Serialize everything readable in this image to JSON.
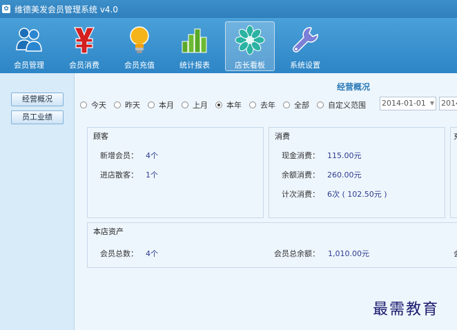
{
  "window": {
    "title": "维德美发会员管理系统 v4.0"
  },
  "toolbar": {
    "items": [
      {
        "label": "会员管理"
      },
      {
        "label": "会员消费"
      },
      {
        "label": "会员充值"
      },
      {
        "label": "统计报表"
      },
      {
        "label": "店长看板"
      },
      {
        "label": "系统设置"
      }
    ],
    "active_index": 4
  },
  "sidebar": {
    "items": [
      {
        "label": "经营概况"
      },
      {
        "label": "员工业绩"
      }
    ]
  },
  "overview": {
    "title": "经营概况",
    "ranges": [
      {
        "label": "今天",
        "checked": false
      },
      {
        "label": "昨天",
        "checked": false
      },
      {
        "label": "本月",
        "checked": false
      },
      {
        "label": "上月",
        "checked": false
      },
      {
        "label": "本年",
        "checked": true
      },
      {
        "label": "去年",
        "checked": false
      },
      {
        "label": "全部",
        "checked": false
      },
      {
        "label": "自定义范围",
        "checked": false
      }
    ],
    "date_from": "2014-01-01",
    "date_to": "2014",
    "customers": {
      "title": "顾客",
      "rows": [
        {
          "key": "新增会员：",
          "value": "4个"
        },
        {
          "key": "进店散客：",
          "value": "1个"
        }
      ]
    },
    "consumption": {
      "title": "消费",
      "rows": [
        {
          "key": "现金消费：",
          "value": "115.00元"
        },
        {
          "key": "余额消费：",
          "value": "260.00元"
        },
        {
          "key": "计次消费：",
          "value": "6次 ( 102.50元 )"
        }
      ]
    },
    "third_panel_title": "充",
    "assets": {
      "title": "本店资产",
      "member_count_label": "会员总数：",
      "member_count_value": "4个",
      "member_balance_label": "会员总余额：",
      "member_balance_value": "1,010.00元",
      "clipped_label": "会"
    }
  },
  "watermark": "最需教育"
}
